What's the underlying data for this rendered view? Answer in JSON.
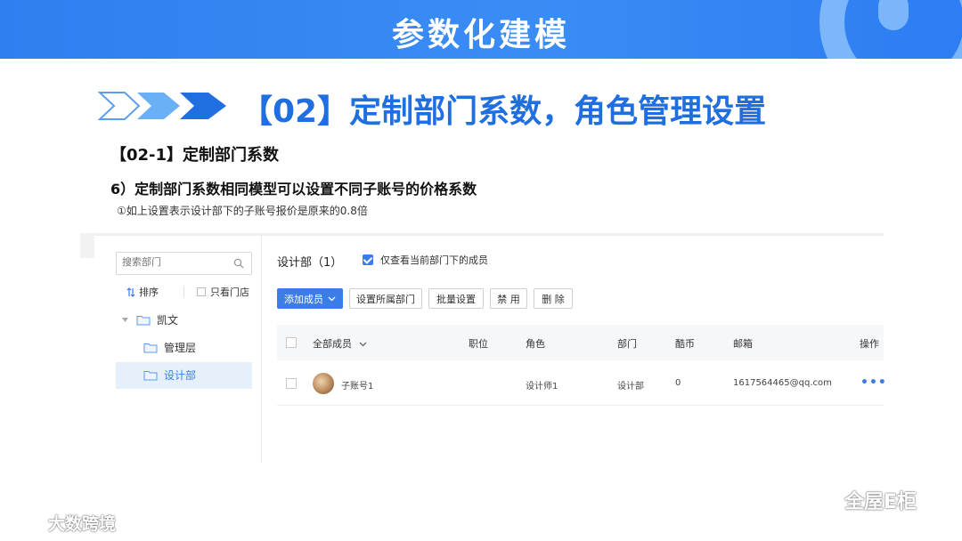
{
  "banner": {
    "title": "参数化建模"
  },
  "heading": {
    "text": "【02】定制部门系数，角色管理设置"
  },
  "section": {
    "subtitle": "【02-1】定制部门系数",
    "point": "6）定制部门系数相同模型可以设置不同子账号的价格系数",
    "note": "①如上设置表示设计部下的子账号报价是原来的0.8倍"
  },
  "sidebar": {
    "search_placeholder": "搜索部门",
    "sort_label": "排序",
    "store_only_label": "只看门店",
    "tree": [
      {
        "label": "凯文"
      },
      {
        "label": "管理层"
      },
      {
        "label": "设计部"
      }
    ]
  },
  "main": {
    "dept_title": "设计部（1）",
    "only_current_label": "仅查看当前部门下的成员",
    "buttons": {
      "add_member": "添加成员",
      "set_dept": "设置所属部门",
      "batch": "批量设置",
      "disable": "禁 用",
      "delete": "删 除"
    },
    "columns": [
      "全部成员",
      "职位",
      "角色",
      "部门",
      "酷币",
      "邮箱",
      "操作"
    ],
    "rows": [
      {
        "name": "子账号1",
        "position": "",
        "role": "设计师1",
        "dept": "设计部",
        "coins": "0",
        "email": "1617564465@qq.com"
      }
    ],
    "accent": "#3b7de6"
  },
  "footer": {
    "watermark_left": "大数跨境",
    "watermark_right": "全屋E柜"
  },
  "colors": {
    "banner": "#2f7ff0",
    "heading": "#1f6fe0"
  }
}
